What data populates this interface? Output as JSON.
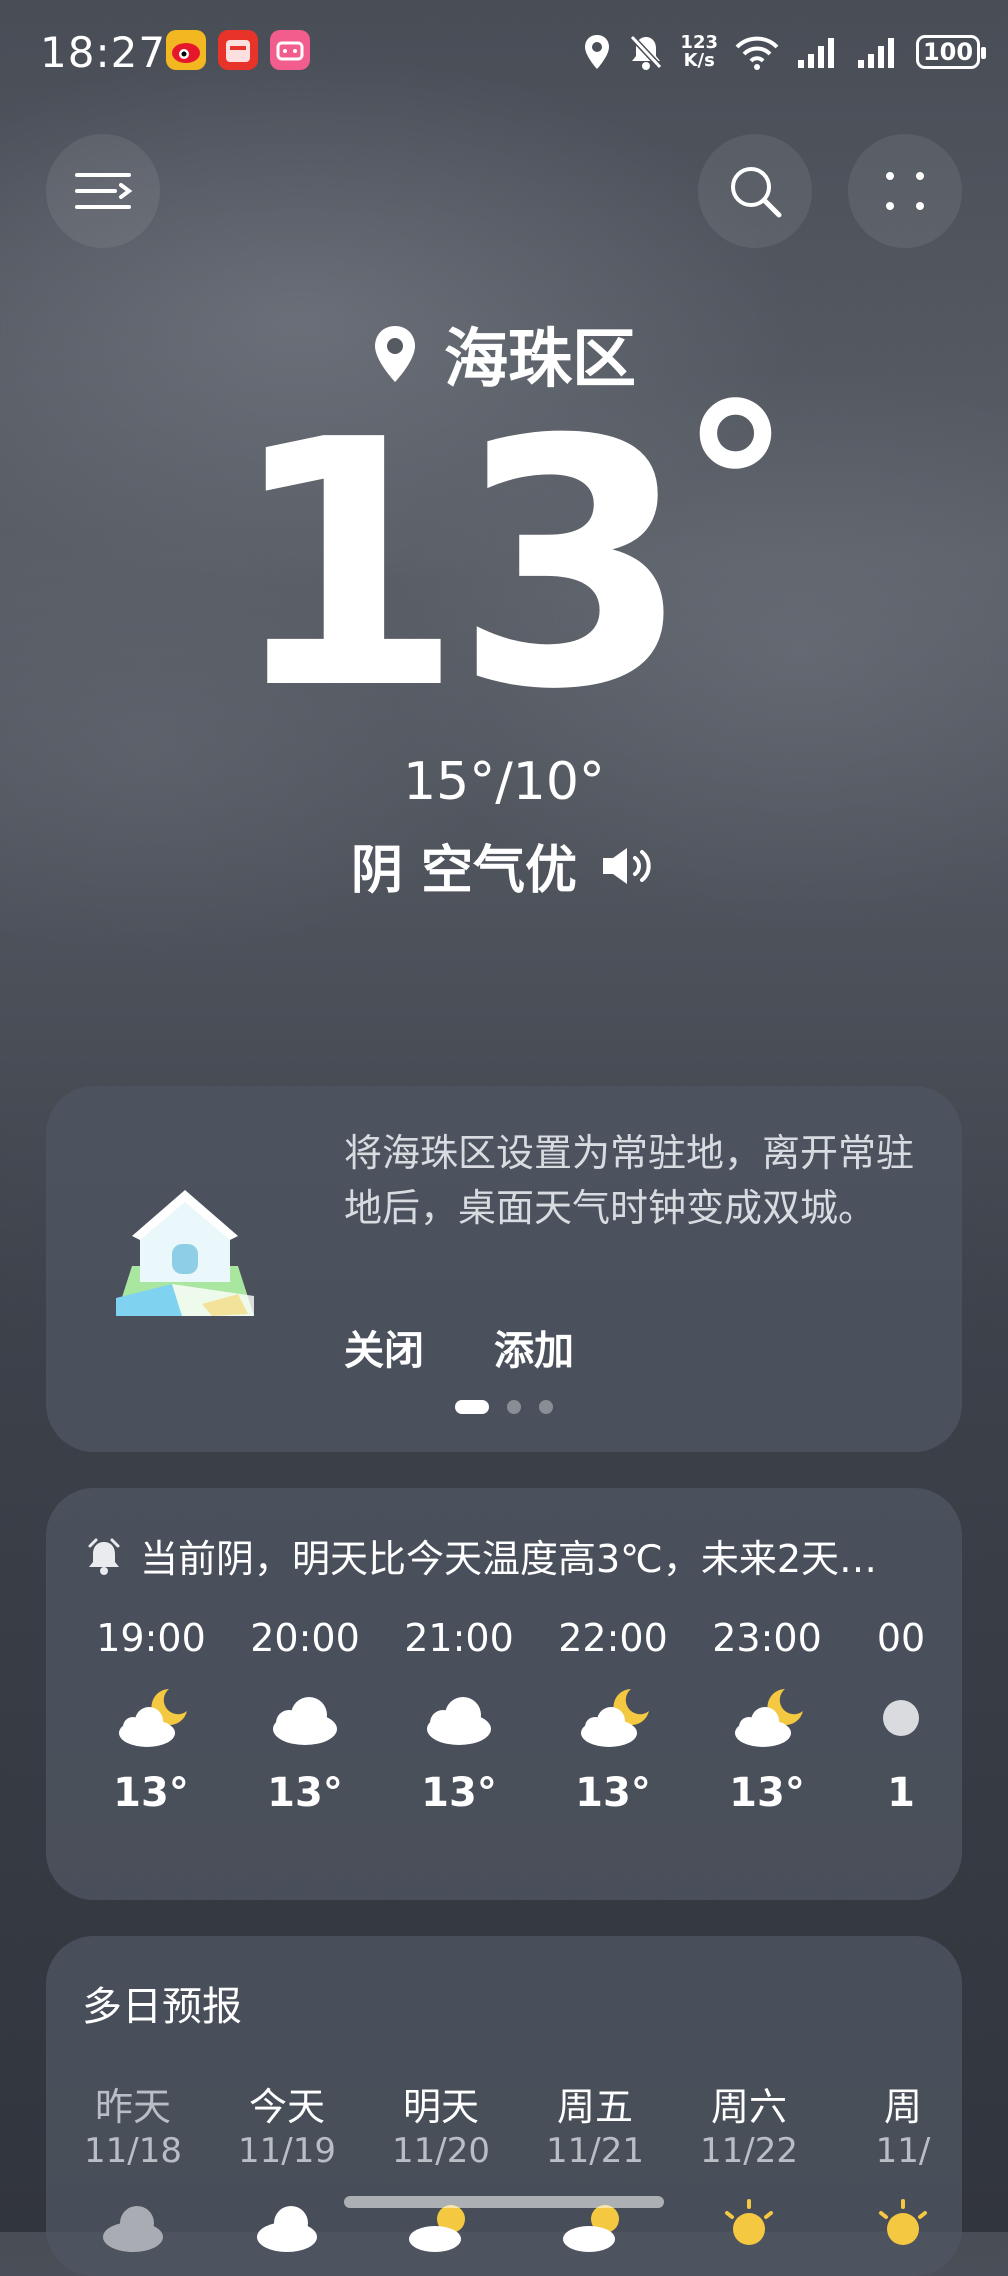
{
  "status_bar": {
    "time": "18:27",
    "speed_top": "123",
    "speed_bottom": "K/s",
    "battery": "100"
  },
  "header": {
    "location": "海珠区",
    "temperature": "13",
    "degree_symbol": "°",
    "range": "15°/10°",
    "condition": "阴 空气优"
  },
  "tip_card": {
    "text": "将海珠区设置为常驻地，离开常驻地后，桌面天气时钟变成双城。",
    "close_label": "关闭",
    "add_label": "添加",
    "pages": 3,
    "active_page": 0
  },
  "hourly": {
    "alert": "当前阴，明天比今天温度高3℃，未来2天…",
    "items": [
      {
        "time": "19:00",
        "icon": "moon-cloud-icon",
        "temp": "13°"
      },
      {
        "time": "20:00",
        "icon": "cloud-icon",
        "temp": "13°"
      },
      {
        "time": "21:00",
        "icon": "cloud-icon",
        "temp": "13°"
      },
      {
        "time": "22:00",
        "icon": "moon-cloud-icon",
        "temp": "13°"
      },
      {
        "time": "23:00",
        "icon": "moon-cloud-icon",
        "temp": "13°"
      },
      {
        "time": "00",
        "icon": "moon-icon",
        "temp": "1"
      }
    ]
  },
  "daily": {
    "title": "多日预报",
    "items": [
      {
        "name": "昨天",
        "date": "11/18",
        "icon": "cloud-icon"
      },
      {
        "name": "今天",
        "date": "11/19",
        "icon": "cloud-icon"
      },
      {
        "name": "明天",
        "date": "11/20",
        "icon": "sun-cloud-icon"
      },
      {
        "name": "周五",
        "date": "11/21",
        "icon": "sun-cloud-icon"
      },
      {
        "name": "周六",
        "date": "11/22",
        "icon": "sun-icon"
      },
      {
        "name": "周",
        "date": "11/",
        "icon": "sun-icon"
      }
    ]
  },
  "colors": {
    "sun": "#f5c842",
    "card": "#505662"
  }
}
